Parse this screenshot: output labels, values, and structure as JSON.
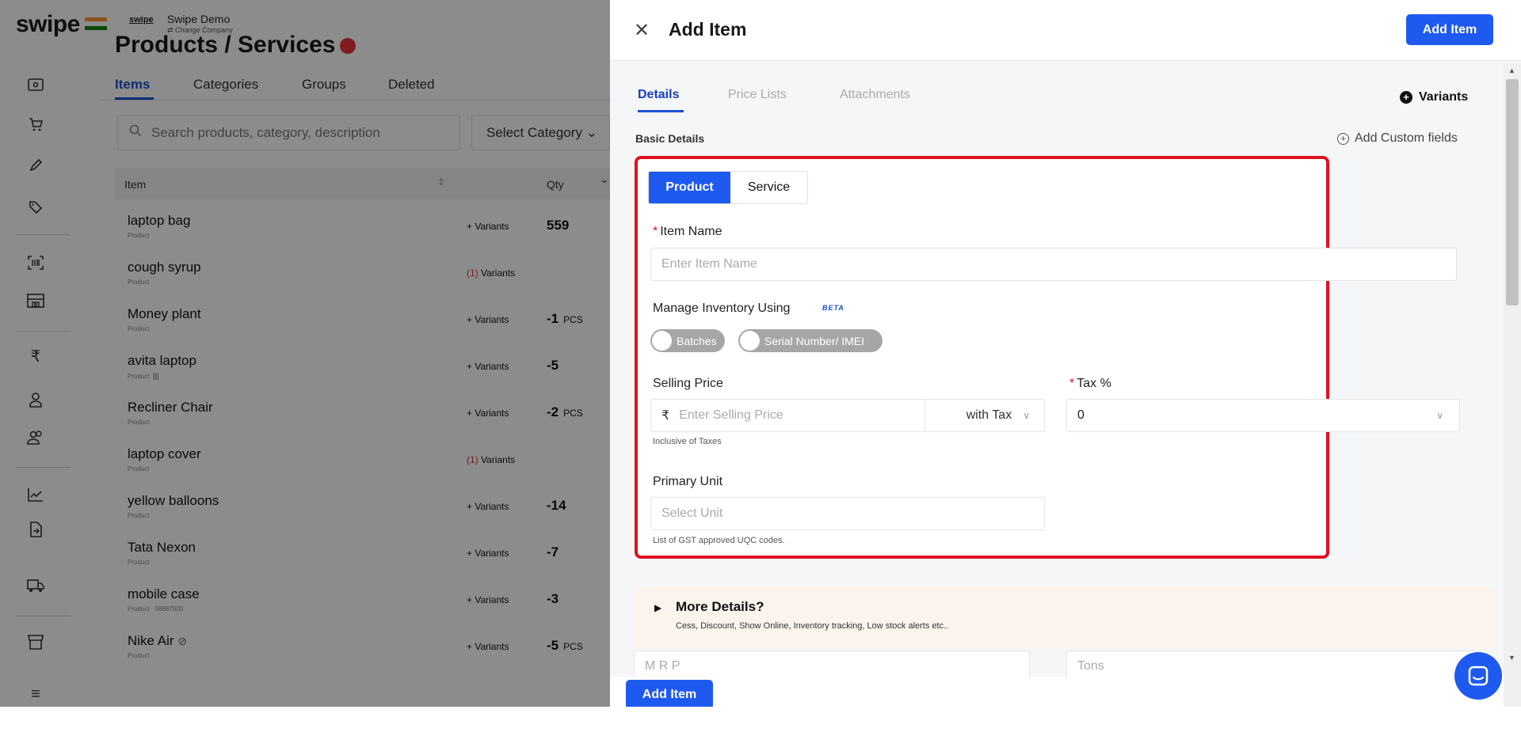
{
  "brand": {
    "logo": "swipe",
    "mini_logo": "swipe",
    "company_name": "Swipe Demo",
    "change_company": "⇄ Change Company"
  },
  "page": {
    "title": "Products / Services"
  },
  "product_tabs": [
    "Items",
    "Categories",
    "Groups",
    "Deleted"
  ],
  "search": {
    "placeholder": "Search products, category, description",
    "category_select": "Select Category"
  },
  "table": {
    "col_item": "Item",
    "col_qty": "Qty",
    "rows": [
      {
        "name": "laptop bag",
        "type": "Product",
        "variants": "+ Variants",
        "qty": "559",
        "unit": ""
      },
      {
        "name": "cough syrup",
        "type": "Product",
        "variants_count": "(1)",
        "variants": "Variants",
        "qty": "",
        "unit": ""
      },
      {
        "name": "Money plant",
        "type": "Product",
        "variants": "+ Variants",
        "qty": "-1",
        "unit": "PCS"
      },
      {
        "name": "avita laptop",
        "type": "Product",
        "variants": "+ Variants",
        "qty": "-5",
        "unit": ""
      },
      {
        "name": "Recliner Chair",
        "type": "Product",
        "variants": "+ Variants",
        "qty": "-2",
        "unit": "PCS"
      },
      {
        "name": "laptop cover",
        "type": "Product",
        "variants_count": "(1)",
        "variants": "Variants",
        "qty": "",
        "unit": ""
      },
      {
        "name": "yellow balloons",
        "type": "Product",
        "variants": "+ Variants",
        "qty": "-14",
        "unit": ""
      },
      {
        "name": "Tata Nexon",
        "type": "Product",
        "variants": "+ Variants",
        "qty": "-7",
        "unit": ""
      },
      {
        "name": "mobile case",
        "type": "Product · 98887900",
        "variants": "+ Variants",
        "qty": "-3",
        "unit": ""
      },
      {
        "name": "Nike Air",
        "type": "Product",
        "variants": "+ Variants",
        "qty": "-5",
        "unit": "PCS"
      }
    ]
  },
  "sidebar_icons": [
    "wallet-icon",
    "cart-icon",
    "pencil-icon",
    "tag-icon",
    "barcode-icon",
    "warehouse-icon",
    "rupee-icon",
    "user-icon",
    "users-icon",
    "chart-icon",
    "import-icon",
    "truck-icon",
    "store-icon",
    "menu-icon"
  ],
  "drawer": {
    "title": "Add Item",
    "add_item_button": "Add Item",
    "tabs": [
      "Details",
      "Price Lists",
      "Attachments"
    ],
    "variants_label": "Variants",
    "basic_details": "Basic Details",
    "custom_fields": "Add Custom fields",
    "form": {
      "type_product": "Product",
      "type_service": "Service",
      "item_name_label": "Item Name",
      "item_name_placeholder": "Enter Item Name",
      "manage_inventory_label": "Manage Inventory Using",
      "beta": "BETA",
      "batches": "Batches",
      "serial": "Serial Number/ IMEI",
      "selling_price_label": "Selling Price",
      "currency": "₹",
      "selling_price_placeholder": "Enter Selling Price",
      "with_tax": "with Tax",
      "inclusive_hint": "Inclusive of Taxes",
      "tax_label": "Tax %",
      "tax_value": "0",
      "primary_unit_label": "Primary Unit",
      "unit_placeholder": "Select Unit",
      "unit_hint": "List of GST approved UQC codes."
    },
    "more": {
      "title": "More Details?",
      "subtitle": "Cess, Discount, Show Online, Inventory tracking, Low stock alerts etc.."
    },
    "mrp_placeholder": "M R P",
    "tons_placeholder": "Tons",
    "bottom_add_button": "Add Item"
  },
  "colors": {
    "primary": "#1f5af0",
    "highlight_border": "#e0111f",
    "more_bg": "#fbf4ed"
  }
}
